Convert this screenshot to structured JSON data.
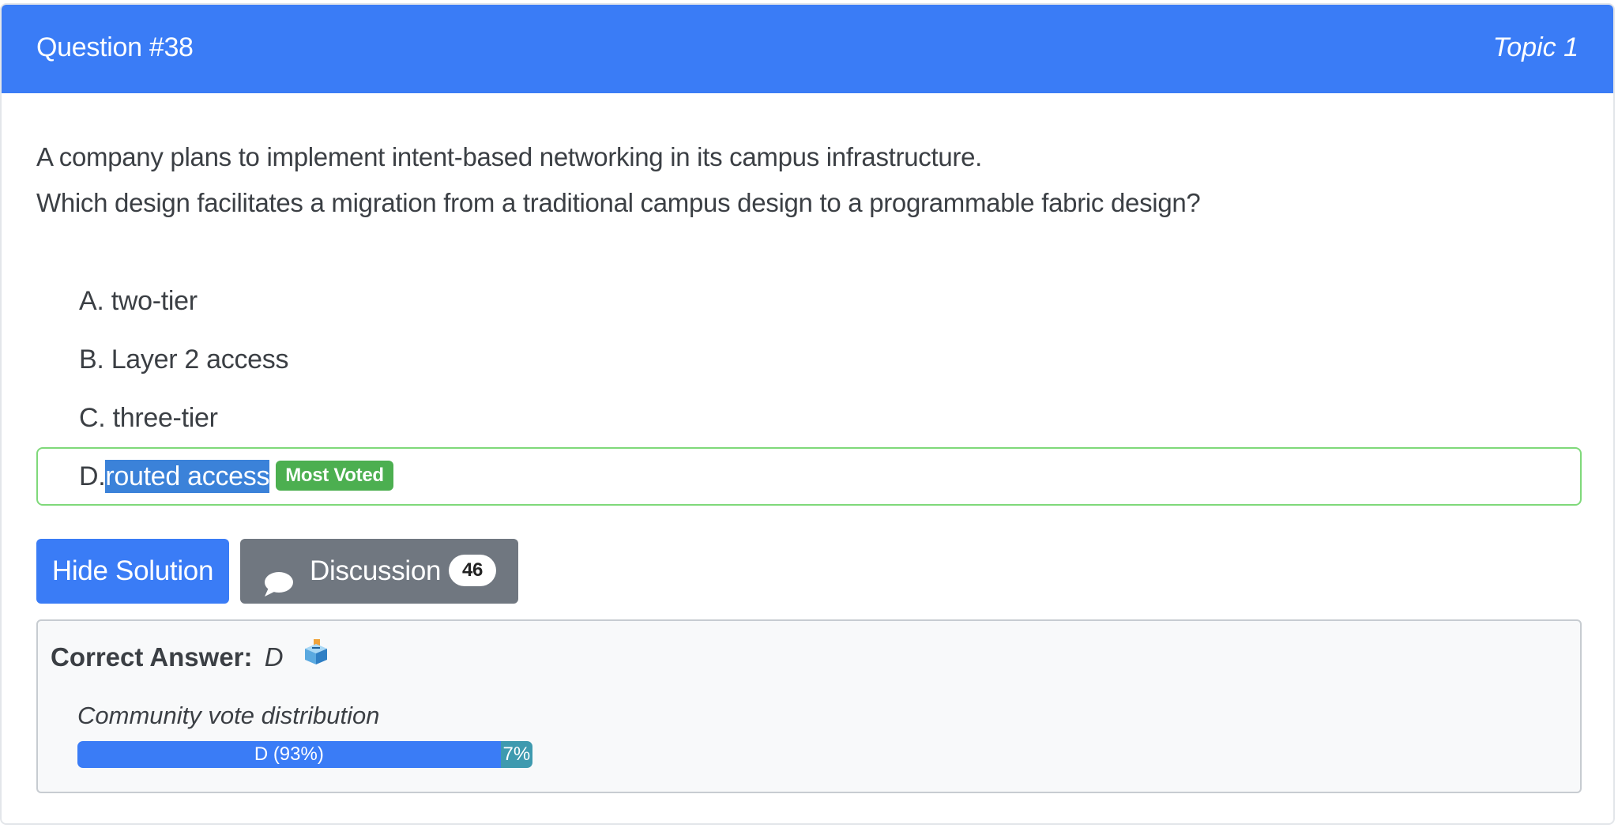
{
  "header": {
    "question_number": "Question #38",
    "topic": "Topic 1"
  },
  "question": {
    "line1": "A company plans to implement intent-based networking in its campus infrastructure.",
    "line2": "Which design facilitates a migration from a traditional campus design to a programmable fabric design?"
  },
  "choices": [
    {
      "letter": "A.",
      "text": "two-tier"
    },
    {
      "letter": "B.",
      "text": "Layer 2 access"
    },
    {
      "letter": "C.",
      "text": "three-tier"
    },
    {
      "letter": "D.",
      "text": "routed access",
      "badge": "Most Voted"
    }
  ],
  "buttons": {
    "hide_solution": "Hide Solution",
    "discussion": "Discussion",
    "discussion_count": "46"
  },
  "answer": {
    "label": "Correct Answer:",
    "value": "D",
    "vote_title": "Community vote distribution",
    "votes": [
      {
        "label": "D (93%)",
        "percent": 93
      },
      {
        "label": "7%",
        "percent": 7
      }
    ]
  },
  "colors": {
    "accent": "#3a7cf6",
    "secondary_button": "#707780",
    "most_voted_badge": "#4caf50",
    "correct_border": "#7fd97a",
    "vote_other": "#3e9aaf"
  },
  "icons": {
    "discussion": "chat-bubble-icon",
    "answer": "ballot-box-icon"
  }
}
